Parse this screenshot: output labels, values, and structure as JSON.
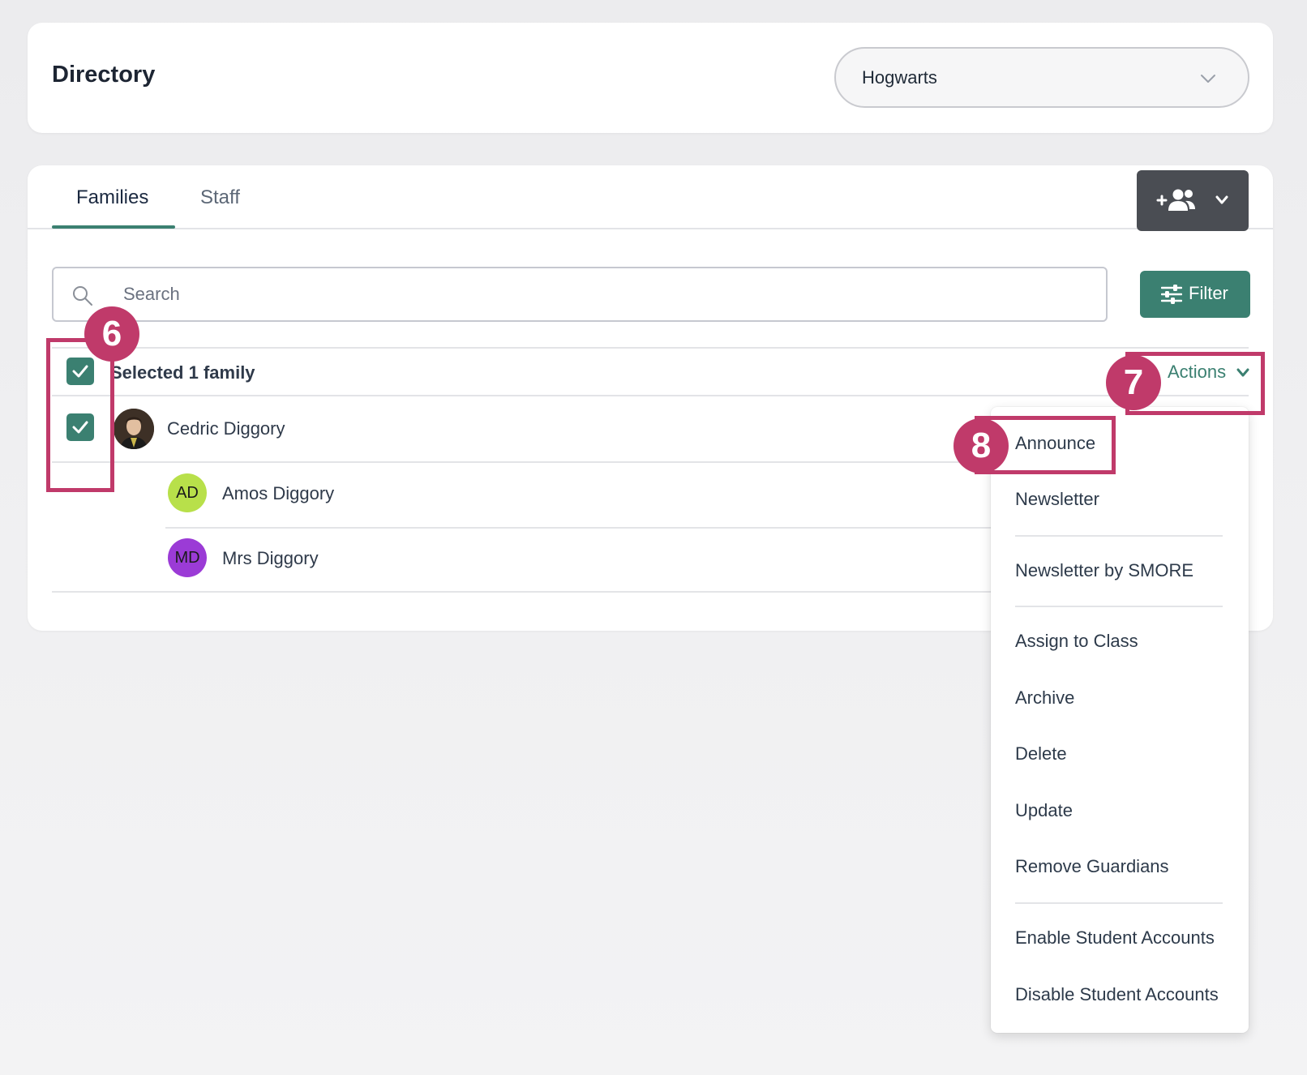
{
  "header": {
    "title": "Directory",
    "school_select": {
      "value": "Hogwarts",
      "icon": "chevron-down-icon"
    }
  },
  "tabs": [
    {
      "label": "Families",
      "active": true
    },
    {
      "label": "Staff",
      "active": false
    }
  ],
  "toolbar": {
    "add_button_icon": "add-person-icon",
    "search_placeholder": "Search",
    "search_value": "",
    "filter_label": "Filter"
  },
  "selection": {
    "label": "Selected 1 family",
    "checked": true,
    "actions_label": "Actions"
  },
  "families": [
    {
      "name": "Cedric Diggory",
      "checked": true,
      "members": [
        {
          "initials": "AD",
          "name": "Amos Diggory",
          "color": "#b8e04a"
        },
        {
          "initials": "MD",
          "name": "Mrs Diggory",
          "color": "#9b3bd6"
        }
      ]
    }
  ],
  "actions_menu": [
    {
      "label": "Announce"
    },
    {
      "label": "Newsletter"
    },
    {
      "label": "Newsletter by SMORE"
    },
    {
      "label": "Assign to Class"
    },
    {
      "label": "Archive"
    },
    {
      "label": "Delete"
    },
    {
      "label": "Update"
    },
    {
      "label": "Remove Guardians"
    },
    {
      "label": "Enable Student Accounts"
    },
    {
      "label": "Disable Student Accounts"
    }
  ],
  "annotations": [
    "6",
    "7",
    "8"
  ],
  "colors": {
    "accent": "#3b8071",
    "dark_button": "#4a4d53",
    "annotation": "#c03a6a"
  }
}
